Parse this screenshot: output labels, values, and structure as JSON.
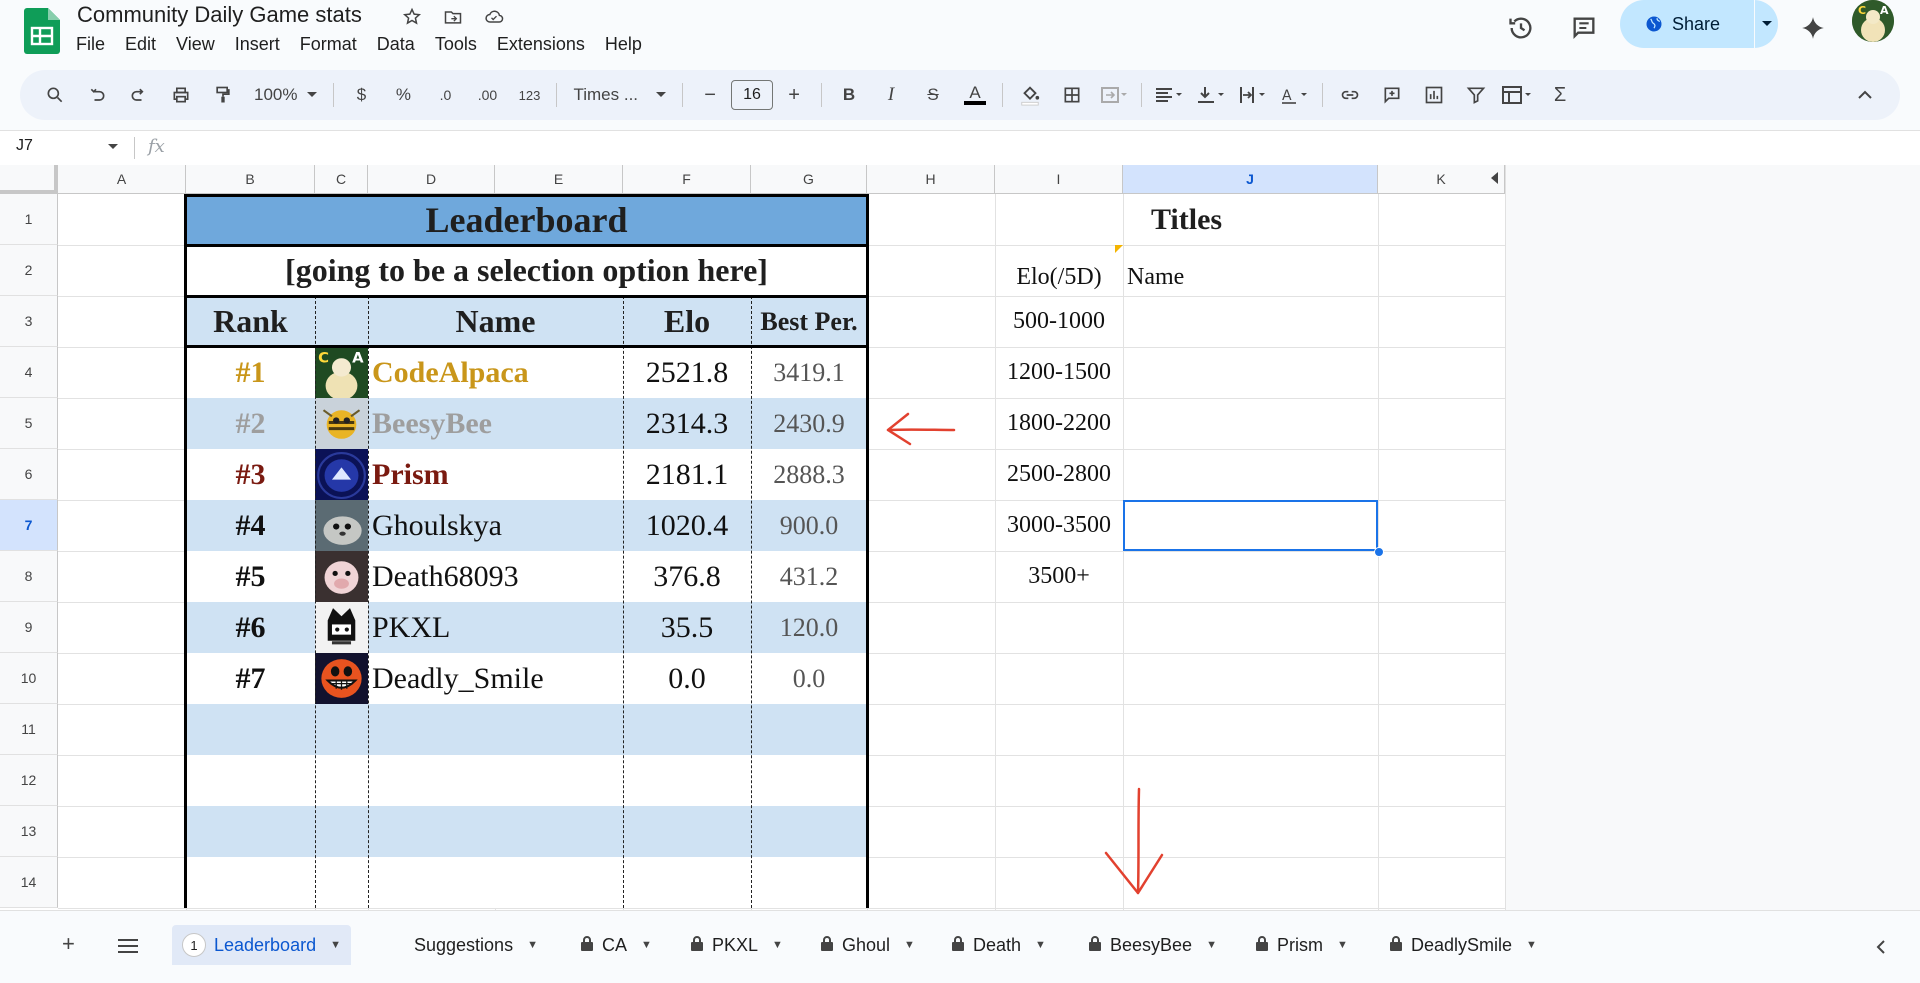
{
  "window": {
    "title": "Community Daily Game stats",
    "menu": [
      "File",
      "Edit",
      "View",
      "Insert",
      "Format",
      "Data",
      "Tools",
      "Extensions",
      "Help"
    ],
    "share_label": "Share"
  },
  "toolbar": {
    "zoom": "100%",
    "currency": "$",
    "percent": "%",
    "dec_decrease": ".0",
    "dec_increase": ".00",
    "number_format": "123",
    "font": "Times ...",
    "minus": "−",
    "font_size": "16",
    "plus": "+",
    "bold": "B",
    "italic": "I",
    "strike": "S",
    "text_color": "A",
    "sum": "Σ"
  },
  "formula_bar": {
    "cell_ref": "J7",
    "fx": "fx"
  },
  "columns": [
    "A",
    "B",
    "C",
    "D",
    "E",
    "F",
    "G",
    "H",
    "I",
    "J",
    "K"
  ],
  "rows": [
    "1",
    "2",
    "3",
    "4",
    "5",
    "6",
    "7",
    "8",
    "9",
    "10",
    "11",
    "12",
    "13",
    "14"
  ],
  "leaderboard": {
    "title": "Leaderboard",
    "subtitle": "[going to be a selection option here]",
    "headers": {
      "rank": "Rank",
      "name": "Name",
      "elo": "Elo",
      "best": "Best Per."
    },
    "entries": [
      {
        "rank": "#1",
        "name": "CodeAlpaca",
        "elo": "2521.8",
        "best": "3419.1",
        "color": "#c9961a",
        "bold": true,
        "avatar": "alpaca"
      },
      {
        "rank": "#2",
        "name": "BeesyBee",
        "elo": "2314.3",
        "best": "2430.9",
        "color": "#9e9e9e",
        "bold": true,
        "avatar": "bee"
      },
      {
        "rank": "#3",
        "name": "Prism",
        "elo": "2181.1",
        "best": "2888.3",
        "color": "#7a1a10",
        "bold": true,
        "avatar": "prism"
      },
      {
        "rank": "#4",
        "name": "Ghoulskya",
        "elo": "1020.4",
        "best": "900.0",
        "color": "#111111",
        "bold": false,
        "avatar": "seal"
      },
      {
        "rank": "#5",
        "name": "Death68093",
        "elo": "376.8",
        "best": "431.2",
        "color": "#111111",
        "bold": false,
        "avatar": "pig"
      },
      {
        "rank": "#6",
        "name": "PKXL",
        "elo": "35.5",
        "best": "120.0",
        "color": "#111111",
        "bold": false,
        "avatar": "cat"
      },
      {
        "rank": "#7",
        "name": "Deadly_Smile",
        "elo": "0.0",
        "best": "0.0",
        "color": "#111111",
        "bold": false,
        "avatar": "smile"
      }
    ]
  },
  "titles_table": {
    "title": "Titles",
    "header_elo": "Elo(/5D)",
    "header_name": "Name",
    "ranges": [
      "500-1000",
      "1200-1500",
      "1800-2200",
      "2500-2800",
      "3000-3500",
      "3500+"
    ]
  },
  "sheet_tabs": [
    {
      "label": "Leaderboard",
      "active": true,
      "locked": false,
      "badge": "1"
    },
    {
      "label": "Suggestions",
      "active": false,
      "locked": false
    },
    {
      "label": "CA",
      "active": false,
      "locked": true
    },
    {
      "label": "PKXL",
      "active": false,
      "locked": true
    },
    {
      "label": "Ghoul",
      "active": false,
      "locked": true
    },
    {
      "label": "Death",
      "active": false,
      "locked": true
    },
    {
      "label": "BeesyBee",
      "active": false,
      "locked": true
    },
    {
      "label": "Prism",
      "active": false,
      "locked": true
    },
    {
      "label": "DeadlySmile",
      "active": false,
      "locked": true
    }
  ],
  "colors": {
    "header_blue": "#6fa8dc",
    "band_blue": "#cfe2f3",
    "selection_blue": "#1a73e8",
    "arrow_red": "#e2412f"
  }
}
